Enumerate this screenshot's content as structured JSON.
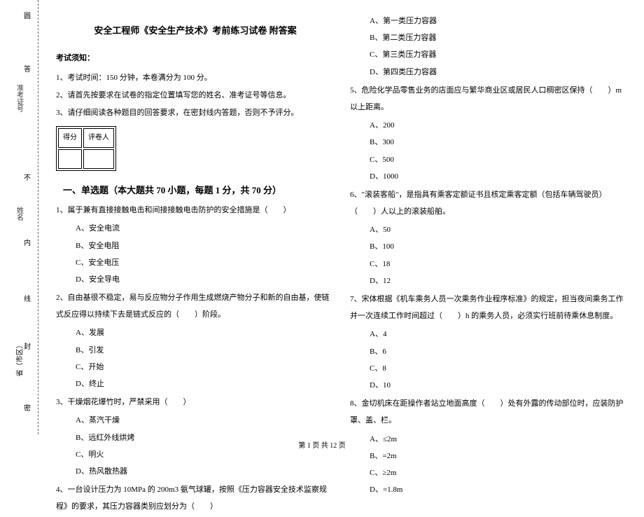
{
  "binding": {
    "circle": "圆",
    "answer": "答",
    "id_label": "准考证号",
    "no": "不",
    "name_label": "姓名",
    "inside": "内",
    "line": "线",
    "seal": "封",
    "province": "省（市区）",
    "secret": "密"
  },
  "header": {
    "title": "安全工程师《安全生产技术》考前练习试卷 附答案",
    "notice_hd": "考试须知：",
    "notice1": "1、考试时间：150 分钟，本卷满分为 100 分。",
    "notice2": "2、请首先按要求在试卷的指定位置填写您的姓名、准考证号等信息。",
    "notice3": "3、请仔细阅读各种题目的回答要求，在密封线内答题，否则不予评分。"
  },
  "score": {
    "got": "得分",
    "grader": "评卷人"
  },
  "section1": {
    "hd": "一、单选题（本大题共 70 小题，每题 1 分，共 70 分）"
  },
  "q1": {
    "stem": "1、属于兼有直接接触电击和间接接触电击防护的安全措施是（　　）",
    "a": "A、安全电流",
    "b": "B、安全电阻",
    "c": "C、安全电压",
    "d": "D、安全导电"
  },
  "q2": {
    "stem": "2、自由基很不稳定，易与反应物分子作用生成燃烧产物分子和新的自由基，使链式反应得以持续下去是链式反应的（　　）阶段。",
    "a": "A、发展",
    "b": "B、引发",
    "c": "C、开始",
    "d": "D、终止"
  },
  "q3": {
    "stem": "3、干燥烟花爆竹时，严禁采用（　　）",
    "a": "A、蒸汽干燥",
    "b": "B、远红外线烘烤",
    "c": "C、明火",
    "d": "D、热风散热器"
  },
  "q4": {
    "stem": "4、一台设计压力为 10MPa 的 200m3 氨气球罐，按照《压力容器安全技术监察规程》的要求，其压力容器类别应划分为（　　）",
    "a": "A、第一类压力容器",
    "b": "B、第二类压力容器",
    "c": "C、第三类压力容器",
    "d": "D、第四类压力容器"
  },
  "q5": {
    "stem": "5、危险化学品零售业务的店面应与繁华商业区或居民人口稠密区保持（　　）m 以上距离。",
    "a": "A、200",
    "b": "B、300",
    "c": "C、500",
    "d": "D、1000"
  },
  "q6": {
    "stem": "6、\"滚装客船\"，是指具有乘客定额证书且核定乘客定额（包括车辆驾驶员）（　　）人以上的滚装船舶。",
    "a": "A、50",
    "b": "B、100",
    "c": "C、18",
    "d": "D、12"
  },
  "q7": {
    "stem": "7、宋体根据《机车乘务人员一次乘务作业程序标准》的规定，担当夜间乘务工作并一次连续工作时间超过（　　）h 的乘务人员，必须实行班前待乘休息制度。",
    "a": "A、4",
    "b": "B、6",
    "c": "C、8",
    "d": "D、10"
  },
  "q8": {
    "stem": "8、金切机床在距操作者站立地面高度（　　）处有外露的传动部位时，应装防护罩、盖、栏。",
    "a": "A、≤2m",
    "b": "B、=2m",
    "c": "C、≥2m",
    "d": "D、=1.8m"
  },
  "footer": "第 1 页 共 12 页"
}
